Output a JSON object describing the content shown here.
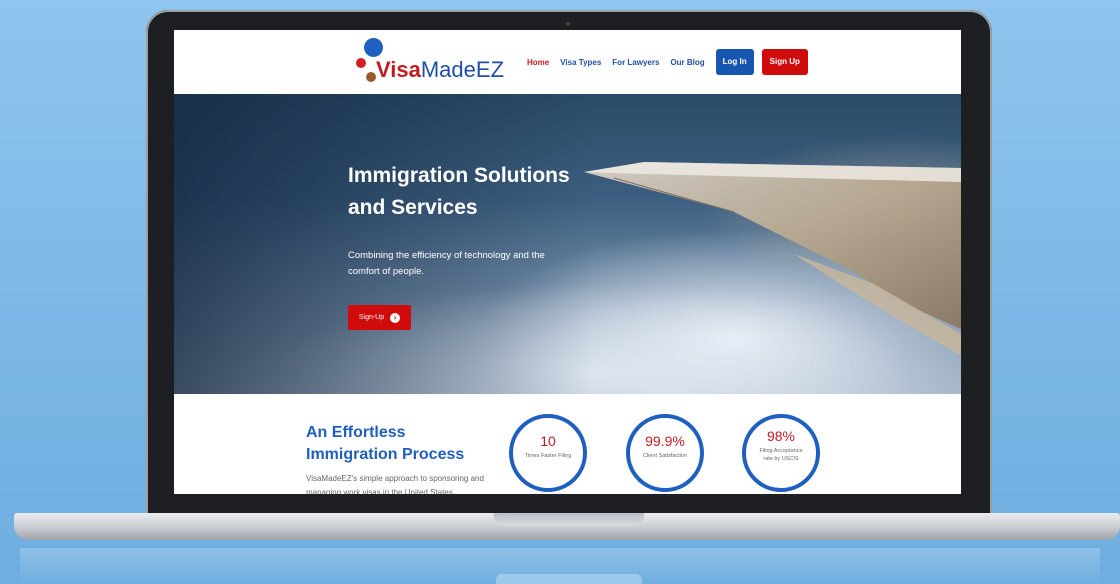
{
  "brand": {
    "name_visa": "Visa",
    "name_rest": "MadeEZ"
  },
  "nav": {
    "items": [
      {
        "label": "Home",
        "active": true
      },
      {
        "label": "Visa Types",
        "active": false
      },
      {
        "label": "For Lawyers",
        "active": false
      },
      {
        "label": "Our Blog",
        "active": false
      }
    ],
    "login_label": "Log In",
    "signup_label": "Sign Up"
  },
  "hero": {
    "title_line1": "Immigration Solutions",
    "title_line2": "and Services",
    "subtitle": "Combining the efficiency of technology and the comfort of people.",
    "cta_label": "Sign-Up",
    "cta_icon": "chevron-right-circle-icon"
  },
  "process": {
    "title_line1": "An Effortless",
    "title_line2": "Immigration Process",
    "description": "VisaMadeEZ's simple approach to sponsoring and managing work visas in the United States"
  },
  "stats": [
    {
      "value": "10",
      "label": "Times Faster Filing"
    },
    {
      "value": "99.9%",
      "label": "Client Satisfaction"
    },
    {
      "value": "98%",
      "label": "Filing Acceptance rate by USCIS"
    }
  ],
  "colors": {
    "brand_blue": "#1f5fbf",
    "brand_red": "#cf0b0b",
    "background": "#8fc5ee"
  }
}
